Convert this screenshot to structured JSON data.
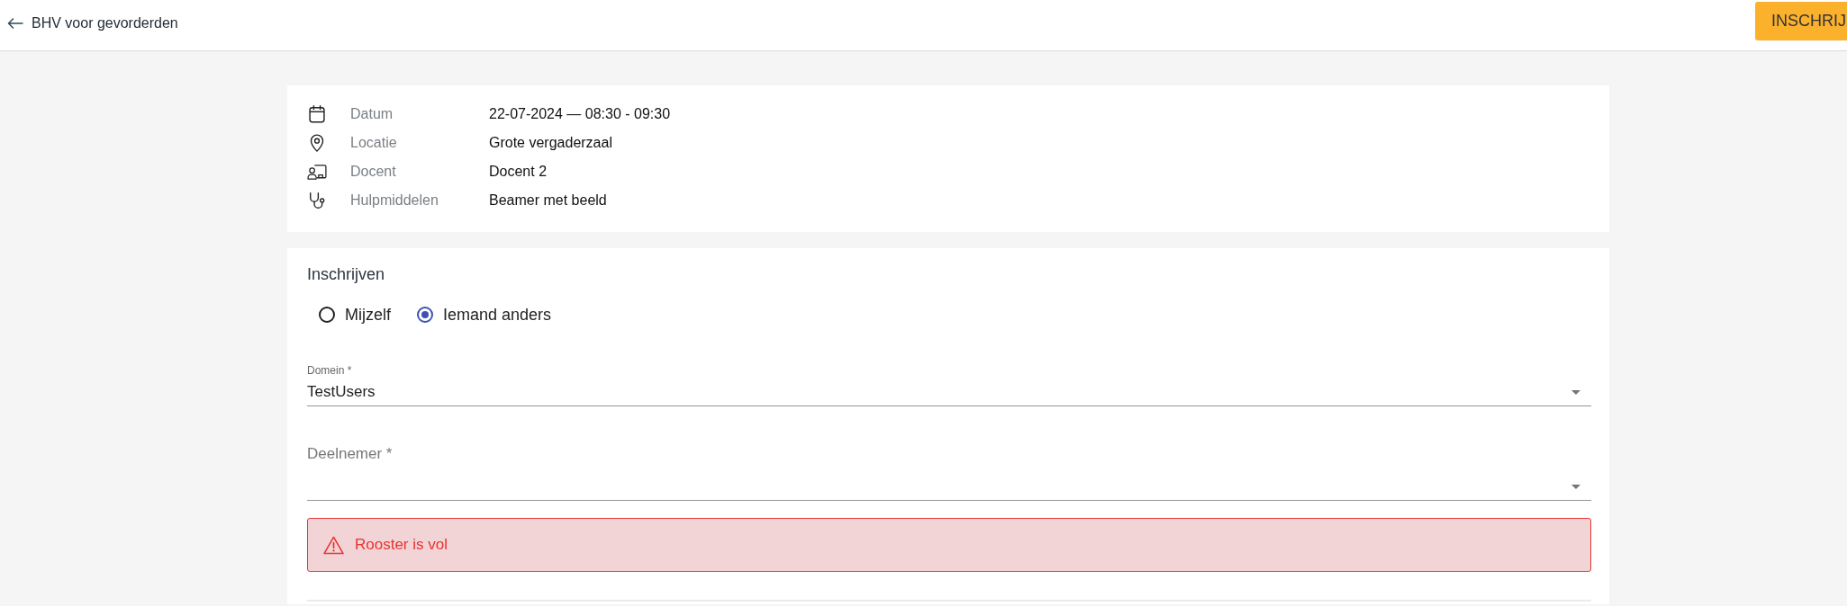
{
  "header": {
    "back_link": "BHV voor gevorderden",
    "action_button": "INSCHRIJ"
  },
  "details": [
    {
      "kind": "date",
      "label": "Datum",
      "value": "22-07-2024 — 08:30 - 09:30"
    },
    {
      "kind": "location",
      "label": "Locatie",
      "value": "Grote vergaderzaal"
    },
    {
      "kind": "teacher",
      "label": "Docent",
      "value": "Docent 2"
    },
    {
      "kind": "equipment",
      "label": "Hulpmiddelen",
      "value": "Beamer met beeld"
    }
  ],
  "enrollment": {
    "title": "Inschrijven",
    "options": [
      {
        "label": "Mijzelf",
        "selected": false
      },
      {
        "label": "Iemand anders",
        "selected": true
      }
    ],
    "fields": [
      {
        "label": "Domein *",
        "value": "TestUsers"
      },
      {
        "label": "Deelnemer *"
      }
    ],
    "alert": {
      "kind": "error",
      "text": "Rooster is vol"
    }
  }
}
